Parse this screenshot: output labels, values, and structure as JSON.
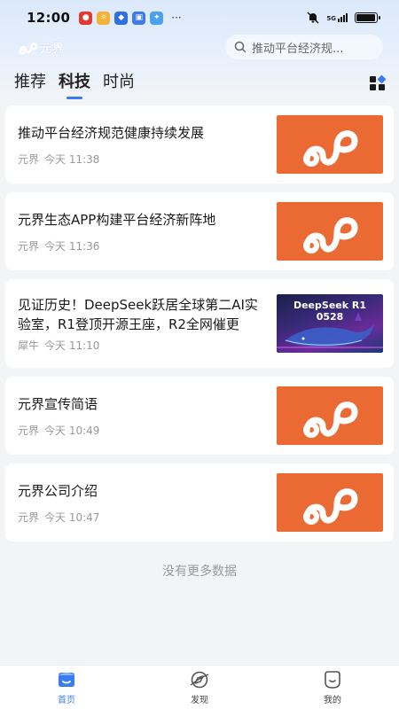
{
  "status_bar": {
    "time": "12:00",
    "dots": "···",
    "signal_label": "5G",
    "battery_level": 0.95
  },
  "header": {
    "logo_text": "元界",
    "search_placeholder": "推动平台经济规..."
  },
  "tabs": [
    {
      "label": "推荐",
      "active": false
    },
    {
      "label": "科技",
      "active": true
    },
    {
      "label": "时尚",
      "active": false
    }
  ],
  "news": [
    {
      "title": "推动平台经济规范健康持续发展",
      "source": "元界",
      "time": "今天 11:38",
      "thumb": "logo"
    },
    {
      "title": "元界生态APP构建平台经济新阵地",
      "source": "元界",
      "time": "今天 11:36",
      "thumb": "logo"
    },
    {
      "title": "见证历史！DeepSeek跃居全球第二AI实验室，R1登顶开源王座，R2全网催更",
      "source": "犀牛",
      "time": "今天 11:10",
      "thumb": "deepseek",
      "thumb_title": "DeepSeek R1",
      "thumb_subtitle": "0528"
    },
    {
      "title": "元界宣传简语",
      "source": "元界",
      "time": "今天 10:49",
      "thumb": "logo"
    },
    {
      "title": "元界公司介绍",
      "source": "元界",
      "time": "今天 10:47",
      "thumb": "logo"
    }
  ],
  "footer_text": "没有更多数据",
  "bottom_nav": [
    {
      "label": "首页",
      "active": true
    },
    {
      "label": "发现",
      "active": false
    },
    {
      "label": "我的",
      "active": false
    }
  ],
  "colors": {
    "accent": "#3a7cf0",
    "thumb_orange": "#eb6a33"
  }
}
